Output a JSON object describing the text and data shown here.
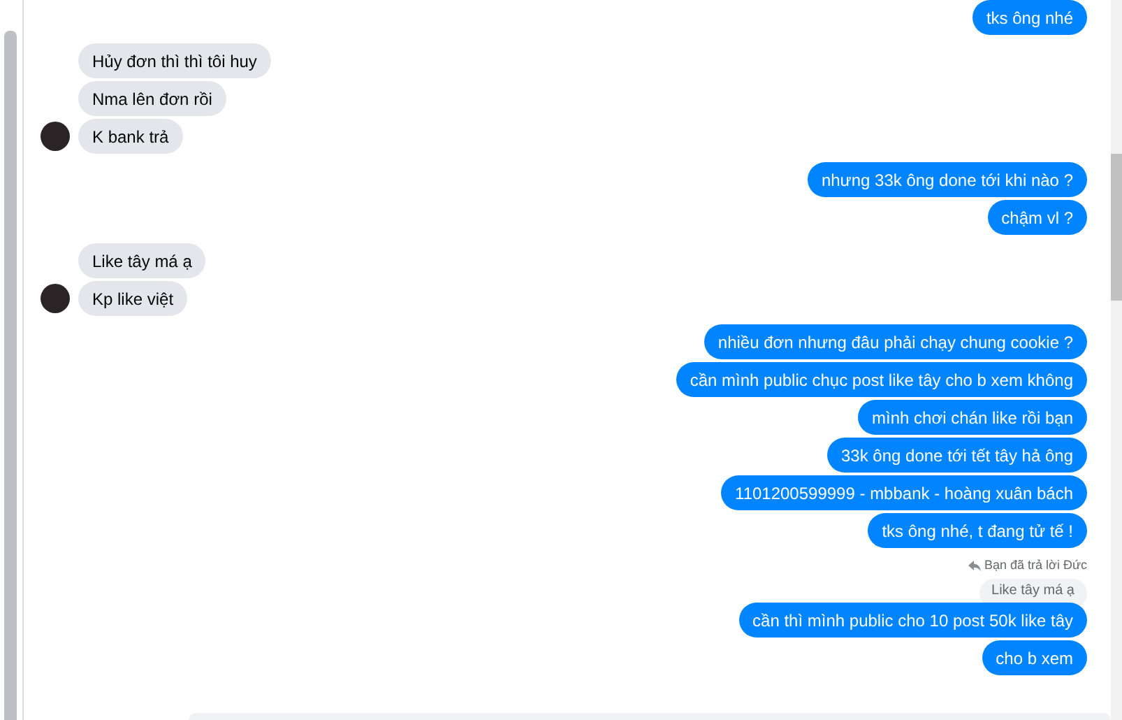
{
  "groups": [
    {
      "kind": "outgoing",
      "messages": [
        "tks ông nhé"
      ]
    },
    {
      "kind": "incoming",
      "avatar": true,
      "messages": [
        "Hủy đơn thì thì tôi huy",
        "Nma lên đơn rồi",
        "K bank trả"
      ]
    },
    {
      "kind": "outgoing",
      "messages": [
        "nhưng 33k ông done tới khi nào ?",
        "chậm vl ?"
      ]
    },
    {
      "kind": "incoming",
      "avatar": true,
      "messages": [
        "Like tây má ạ",
        "Kp like việt"
      ]
    },
    {
      "kind": "outgoing",
      "messages": [
        "nhiều đơn nhưng đâu phải chạy chung cookie ?",
        "cần mình public chục post like tây cho b xem không",
        "mình chơi chán like rồi bạn",
        "33k ông done tới tết tây hả ông",
        "1101200599999 - mbbank - hoàng xuân bách",
        "tks ông nhé, t đang tử tế  !"
      ]
    },
    {
      "kind": "outgoing",
      "reply": {
        "label": "Bạn đã trả lời Đức",
        "quote": "Like tây má ạ"
      },
      "messages": [
        "cần thì mình public cho 10 post 50k like tây",
        "cho b xem"
      ]
    }
  ]
}
